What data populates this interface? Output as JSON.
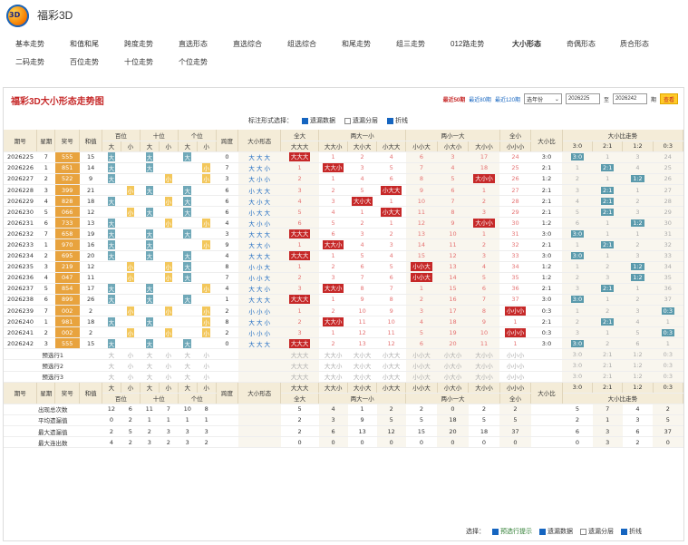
{
  "app": {
    "title": "福彩3D",
    "logo_text": "3D"
  },
  "nav": {
    "row1": [
      "基本走势",
      "和值和尾",
      "跨度走势",
      "直选形态",
      "直选综合",
      "组选综合",
      "和尾走势",
      "组三走势",
      "012路走势",
      "大小形态",
      "奇偶形态",
      "质合形态"
    ],
    "row2": [
      "二码走势",
      "百位走势",
      "十位走势",
      "个位走势"
    ],
    "active": "大小形态"
  },
  "panel": {
    "title": "福彩3D大小形态走势图",
    "recent": [
      "最近50期",
      "最近80期",
      "最近120期"
    ],
    "select": "选年份",
    "from": "2026225",
    "to_label": "至",
    "to": "2026242",
    "period_label": "期",
    "query": "查看"
  },
  "options": {
    "label": "标注形式选择：",
    "items": [
      "遗漏数据",
      "遗漏分层",
      "折线"
    ]
  },
  "headers": {
    "period": "期号",
    "week": "星期",
    "prize": "奖号",
    "sum": "和值",
    "hundreds": "百位",
    "tens": "十位",
    "units": "个位",
    "span": "跨度",
    "shape": "大小形态",
    "allbig": "全大",
    "two_big": "两大一小",
    "two_small": "两小一大",
    "allsmall": "全小",
    "ratio": "大小比",
    "trend": "大小比走势",
    "big": "大",
    "small": "小",
    "sub_allbig": "大大大",
    "tb": [
      "大大小",
      "大小大",
      "小大大"
    ],
    "ts": [
      "小小大",
      "小大小",
      "大小小"
    ],
    "sub_allsmall": "小小小",
    "ratios": [
      "3:0",
      "2:1",
      "1:2",
      "0:3"
    ]
  },
  "rows": [
    {
      "p": "2026225",
      "w": "7",
      "n": "555",
      "s": "15",
      "h": "大",
      "t": "大",
      "u": "大",
      "sp": "0",
      "sh": "大 大 大",
      "ab": "大大大",
      "tb": [
        "1",
        "2",
        "4"
      ],
      "ts": [
        "6",
        "3",
        "17"
      ],
      "as": "24",
      "r": "3:0",
      "rt": [
        "3:0",
        "1",
        "3",
        "24"
      ]
    },
    {
      "p": "2026226",
      "w": "1",
      "n": "851",
      "s": "14",
      "h": "大",
      "t": "大",
      "u": "小",
      "sp": "7",
      "sh": "大 大 小",
      "ab": "1",
      "tb": [
        "大大小",
        "3",
        "5"
      ],
      "ts": [
        "7",
        "4",
        "18"
      ],
      "as": "25",
      "r": "2:1",
      "rt": [
        "1",
        "2:1",
        "4",
        "25"
      ]
    },
    {
      "p": "2026227",
      "w": "2",
      "n": "522",
      "s": "9",
      "h": "大",
      "t": "小",
      "u": "小",
      "sp": "3",
      "sh": "大 小 小",
      "ab": "2",
      "tb": [
        "1",
        "4",
        "6"
      ],
      "ts": [
        "8",
        "5",
        "大小小"
      ],
      "as": "26",
      "r": "1:2",
      "rt": [
        "2",
        "1",
        "1:2",
        "26"
      ]
    },
    {
      "p": "2026228",
      "w": "3",
      "n": "399",
      "s": "21",
      "h": "小",
      "t": "大",
      "u": "大",
      "sp": "6",
      "sh": "小 大 大",
      "ab": "3",
      "tb": [
        "2",
        "5",
        "小大大"
      ],
      "ts": [
        "9",
        "6",
        "1"
      ],
      "as": "27",
      "r": "2:1",
      "rt": [
        "3",
        "2:1",
        "1",
        "27"
      ]
    },
    {
      "p": "2026229",
      "w": "4",
      "n": "828",
      "s": "18",
      "h": "大",
      "t": "小",
      "u": "大",
      "sp": "6",
      "sh": "大 小 大",
      "ab": "4",
      "tb": [
        "3",
        "大小大",
        "1"
      ],
      "ts": [
        "10",
        "7",
        "2"
      ],
      "as": "28",
      "r": "2:1",
      "rt": [
        "4",
        "2:1",
        "2",
        "28"
      ]
    },
    {
      "p": "2026230",
      "w": "5",
      "n": "066",
      "s": "12",
      "h": "小",
      "t": "大",
      "u": "大",
      "sp": "6",
      "sh": "小 大 大",
      "ab": "5",
      "tb": [
        "4",
        "1",
        "小大大"
      ],
      "ts": [
        "11",
        "8",
        "3"
      ],
      "as": "29",
      "r": "2:1",
      "rt": [
        "5",
        "2:1",
        "3",
        "29"
      ]
    },
    {
      "p": "2026231",
      "w": "6",
      "n": "733",
      "s": "13",
      "h": "大",
      "t": "小",
      "u": "小",
      "sp": "4",
      "sh": "大 小 小",
      "ab": "6",
      "tb": [
        "5",
        "2",
        "1"
      ],
      "ts": [
        "12",
        "9",
        "大小小"
      ],
      "as": "30",
      "r": "1:2",
      "rt": [
        "6",
        "1",
        "1:2",
        "30"
      ]
    },
    {
      "p": "2026232",
      "w": "7",
      "n": "658",
      "s": "19",
      "h": "大",
      "t": "大",
      "u": "大",
      "sp": "3",
      "sh": "大 大 大",
      "ab": "大大大",
      "tb": [
        "6",
        "3",
        "2"
      ],
      "ts": [
        "13",
        "10",
        "1"
      ],
      "as": "31",
      "r": "3:0",
      "rt": [
        "3:0",
        "1",
        "1",
        "31"
      ]
    },
    {
      "p": "2026233",
      "w": "1",
      "n": "970",
      "s": "16",
      "h": "大",
      "t": "大",
      "u": "小",
      "sp": "9",
      "sh": "大 大 小",
      "ab": "1",
      "tb": [
        "大大小",
        "4",
        "3"
      ],
      "ts": [
        "14",
        "11",
        "2"
      ],
      "as": "32",
      "r": "2:1",
      "rt": [
        "1",
        "2:1",
        "2",
        "32"
      ]
    },
    {
      "p": "2026234",
      "w": "2",
      "n": "695",
      "s": "20",
      "h": "大",
      "t": "大",
      "u": "大",
      "sp": "4",
      "sh": "大 大 大",
      "ab": "大大大",
      "tb": [
        "1",
        "5",
        "4"
      ],
      "ts": [
        "15",
        "12",
        "3"
      ],
      "as": "33",
      "r": "3:0",
      "rt": [
        "3:0",
        "1",
        "3",
        "33"
      ]
    },
    {
      "p": "2026235",
      "w": "3",
      "n": "219",
      "s": "12",
      "h": "小",
      "t": "小",
      "u": "大",
      "sp": "8",
      "sh": "小 小 大",
      "ab": "1",
      "tb": [
        "2",
        "6",
        "5"
      ],
      "ts": [
        "小小大",
        "13",
        "4"
      ],
      "as": "34",
      "r": "1:2",
      "rt": [
        "1",
        "2",
        "1:2",
        "34"
      ]
    },
    {
      "p": "2026236",
      "w": "4",
      "n": "047",
      "s": "11",
      "h": "小",
      "t": "小",
      "u": "大",
      "sp": "7",
      "sh": "小 小 大",
      "ab": "2",
      "tb": [
        "3",
        "7",
        "6"
      ],
      "ts": [
        "小小大",
        "14",
        "5"
      ],
      "as": "35",
      "r": "1:2",
      "rt": [
        "2",
        "3",
        "1:2",
        "35"
      ]
    },
    {
      "p": "2026237",
      "w": "5",
      "n": "854",
      "s": "17",
      "h": "大",
      "t": "大",
      "u": "小",
      "sp": "4",
      "sh": "大 大 小",
      "ab": "3",
      "tb": [
        "大大小",
        "8",
        "7"
      ],
      "ts": [
        "1",
        "15",
        "6"
      ],
      "as": "36",
      "r": "2:1",
      "rt": [
        "3",
        "2:1",
        "1",
        "36"
      ]
    },
    {
      "p": "2026238",
      "w": "6",
      "n": "899",
      "s": "26",
      "h": "大",
      "t": "大",
      "u": "大",
      "sp": "1",
      "sh": "大 大 大",
      "ab": "大大大",
      "tb": [
        "1",
        "9",
        "8"
      ],
      "ts": [
        "2",
        "16",
        "7"
      ],
      "as": "37",
      "r": "3:0",
      "rt": [
        "3:0",
        "1",
        "2",
        "37"
      ]
    },
    {
      "p": "2026239",
      "w": "7",
      "n": "002",
      "s": "2",
      "h": "小",
      "t": "小",
      "u": "小",
      "sp": "2",
      "sh": "小 小 小",
      "ab": "1",
      "tb": [
        "2",
        "10",
        "9"
      ],
      "ts": [
        "3",
        "17",
        "8"
      ],
      "as": "小小小",
      "r": "0:3",
      "rt": [
        "1",
        "2",
        "3",
        "0:3"
      ]
    },
    {
      "p": "2026240",
      "w": "1",
      "n": "981",
      "s": "18",
      "h": "大",
      "t": "大",
      "u": "小",
      "sp": "8",
      "sh": "大 大 小",
      "ab": "2",
      "tb": [
        "大大小",
        "11",
        "10"
      ],
      "ts": [
        "4",
        "18",
        "9"
      ],
      "as": "1",
      "r": "2:1",
      "rt": [
        "2",
        "2:1",
        "4",
        "1"
      ]
    },
    {
      "p": "2026241",
      "w": "2",
      "n": "002",
      "s": "2",
      "h": "小",
      "t": "小",
      "u": "小",
      "sp": "2",
      "sh": "小 小 小",
      "ab": "3",
      "tb": [
        "1",
        "12",
        "11"
      ],
      "ts": [
        "5",
        "19",
        "10"
      ],
      "as": "小小小",
      "r": "0:3",
      "rt": [
        "3",
        "1",
        "5",
        "0:3"
      ]
    },
    {
      "p": "2026242",
      "w": "3",
      "n": "555",
      "s": "15",
      "h": "大",
      "t": "大",
      "u": "大",
      "sp": "0",
      "sh": "大 大 大",
      "ab": "大大大",
      "tb": [
        "2",
        "13",
        "12"
      ],
      "ts": [
        "6",
        "20",
        "11"
      ],
      "as": "1",
      "r": "3:0",
      "rt": [
        "3:0",
        "2",
        "6",
        "1"
      ]
    }
  ],
  "predict": [
    "预选行1",
    "预选行2",
    "预选行3"
  ],
  "stats": {
    "headers": {
      "period": "期号",
      "week": "星期",
      "prize": "奖号",
      "sum": "和值",
      "hundreds": "百位",
      "tens": "十位",
      "units": "个位",
      "span": "跨度",
      "shape": "大小形态",
      "allbig": "全大",
      "two_big": "两大一小",
      "two_small": "两小一大",
      "allsmall": "全小",
      "ratio": "大小比",
      "trend": "大小比走势"
    },
    "rows": [
      {
        "label": "出现总次数",
        "v": [
          "12",
          "6",
          "11",
          "7",
          "10",
          "8"
        ],
        "g": [
          "5",
          "4",
          "1",
          "2",
          "2",
          "0",
          "2",
          "2",
          "5",
          "7",
          "4",
          "2"
        ]
      },
      {
        "label": "平均遗漏值",
        "v": [
          "0",
          "2",
          "1",
          "1",
          "1",
          "1"
        ],
        "g": [
          "2",
          "3",
          "9",
          "5",
          "5",
          "18",
          "5",
          "5",
          "2",
          "1",
          "3",
          "5"
        ]
      },
      {
        "label": "最大遗漏值",
        "v": [
          "2",
          "5",
          "2",
          "3",
          "3",
          "3"
        ],
        "g": [
          "2",
          "6",
          "13",
          "12",
          "15",
          "20",
          "18",
          "37",
          "6",
          "3",
          "6",
          "37"
        ]
      },
      {
        "label": "最大连出数",
        "v": [
          "4",
          "2",
          "3",
          "2",
          "3",
          "2"
        ],
        "g": [
          "0",
          "0",
          "0",
          "0",
          "0",
          "0",
          "0",
          "0",
          "0",
          "3",
          "2",
          "0"
        ]
      }
    ]
  },
  "footer": {
    "label": "选择：",
    "items": [
      "预选行提示",
      "遗漏数据",
      "遗漏分层",
      "折线"
    ]
  }
}
